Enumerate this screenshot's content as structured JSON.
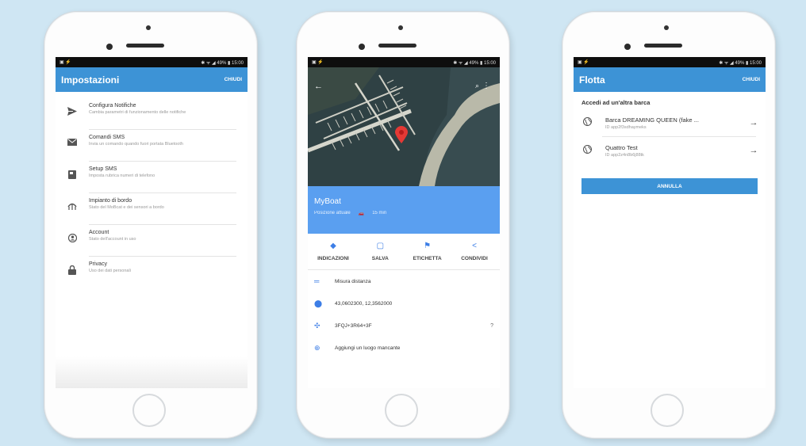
{
  "status_bar": {
    "left": "▣ ⚡",
    "right": "✱ ᯤ ◢ 49% ▮ 15:00"
  },
  "settings": {
    "title": "Impostazioni",
    "action": "CHIUDI",
    "items": [
      {
        "icon": "send-icon",
        "title": "Configura Notifiche",
        "desc": "Cambia parametri di funzionamento delle notifiche"
      },
      {
        "icon": "mail-icon",
        "title": "Comandi SMS",
        "desc": "Invia un comando quando fuori portata Bluetooth"
      },
      {
        "icon": "contact-book-icon",
        "title": "Setup SMS",
        "desc": "Imposta rubrica numeri di telefono"
      },
      {
        "icon": "boat-icon",
        "title": "Impianto di bordo",
        "desc": "Stato del MoBcat e dei sensori a bordo"
      },
      {
        "icon": "account-icon",
        "title": "Account",
        "desc": "Stato dell'account in uso"
      },
      {
        "icon": "lock-icon",
        "title": "Privacy",
        "desc": "Uso dei dati personali"
      }
    ]
  },
  "map": {
    "place_name": "MyBoat",
    "place_sub": "Posizione attuale",
    "place_time": "15 min",
    "actions": [
      {
        "icon": "directions-icon",
        "label": "INDICAZIONI"
      },
      {
        "icon": "bookmark-icon",
        "label": "SALVA"
      },
      {
        "icon": "flag-icon",
        "label": "ETICHETTA"
      },
      {
        "icon": "share-icon",
        "label": "CONDIVIDI"
      }
    ],
    "info": [
      {
        "icon": "ruler-icon",
        "text": "Misura distanza",
        "extra": ""
      },
      {
        "icon": "pin-icon",
        "text": "43,0602300, 12,3562000",
        "extra": ""
      },
      {
        "icon": "pluscode-icon",
        "text": "3FQJ+3R64+3F",
        "extra": "?"
      },
      {
        "icon": "add-place-icon",
        "text": "Aggiungi un luogo mancante",
        "extra": ""
      }
    ]
  },
  "fleet": {
    "title": "Flotta",
    "action": "CHIUDI",
    "heading": "Accedi ad un'altra barca",
    "boats": [
      {
        "name": "Barca DREAMING QUEEN (fake ...",
        "id": "ID app2f3sdhaymeks"
      },
      {
        "name": "Quattro Test",
        "id": "ID app2z4n8b6j88tk"
      }
    ],
    "cancel": "ANNULLA"
  },
  "colors": {
    "accent": "#3d93d6",
    "map_header": "#5a9ff0",
    "background": "#cfe6f3"
  }
}
